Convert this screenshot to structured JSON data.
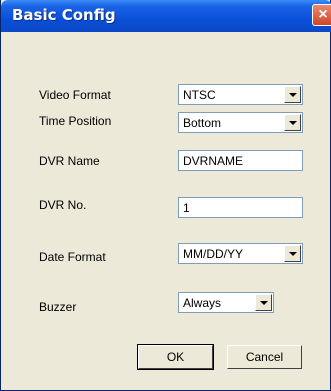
{
  "window": {
    "title": "Basic Config"
  },
  "video_format": {
    "label": "Video Format",
    "value": "NTSC"
  },
  "time_position": {
    "label": "Time Position",
    "value": "Bottom"
  },
  "dvr_name": {
    "label": "DVR Name",
    "value": "DVRNAME"
  },
  "dvr_no": {
    "label": "DVR No.",
    "value": "1"
  },
  "date_format": {
    "label": "Date Format",
    "value": "MM/DD/YY"
  },
  "buzzer": {
    "label": "Buzzer",
    "value": "Always"
  },
  "buttons": {
    "ok": "OK",
    "cancel": "Cancel"
  },
  "icons": {
    "close": "close-icon",
    "dropdown": "chevron-down-icon"
  }
}
